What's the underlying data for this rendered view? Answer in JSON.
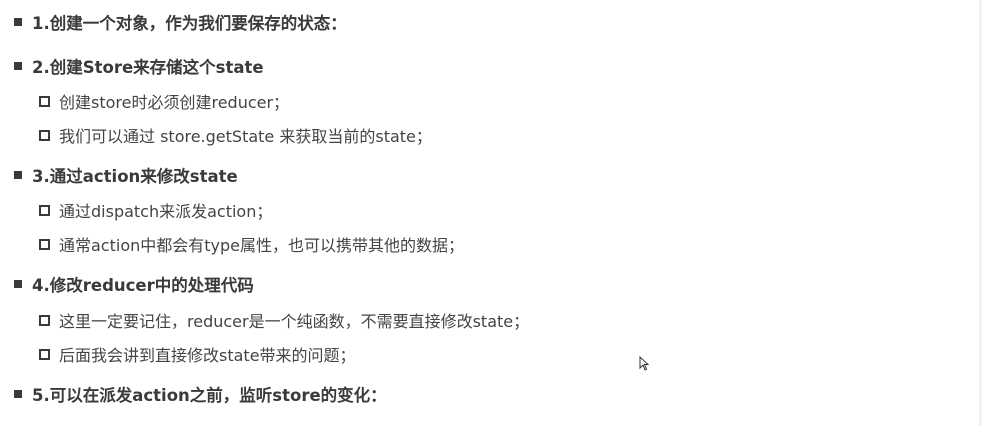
{
  "outline": {
    "item1": "1.创建一个对象，作为我们要保存的状态：",
    "item2": "2.创建Store来存储这个state",
    "item2_sub1": "创建store时必须创建reducer；",
    "item2_sub2": "我们可以通过 store.getState 来获取当前的state；",
    "item3": "3.通过action来修改state",
    "item3_sub1": "通过dispatch来派发action；",
    "item3_sub2": "通常action中都会有type属性，也可以携带其他的数据；",
    "item4": "4.修改reducer中的处理代码",
    "item4_sub1": "这里一定要记住，reducer是一个纯函数，不需要直接修改state；",
    "item4_sub2": "后面我会讲到直接修改state带来的问题；",
    "item5": "5.可以在派发action之前，监听store的变化："
  },
  "icons": {
    "level1_bullet": "filled-square-bullet-icon",
    "level2_bullet": "hollow-square-bullet-icon",
    "cursor": "mouse-pointer-icon"
  },
  "colors": {
    "text": "#333333",
    "bullet": "#3a3a3a",
    "background": "#ffffff"
  }
}
